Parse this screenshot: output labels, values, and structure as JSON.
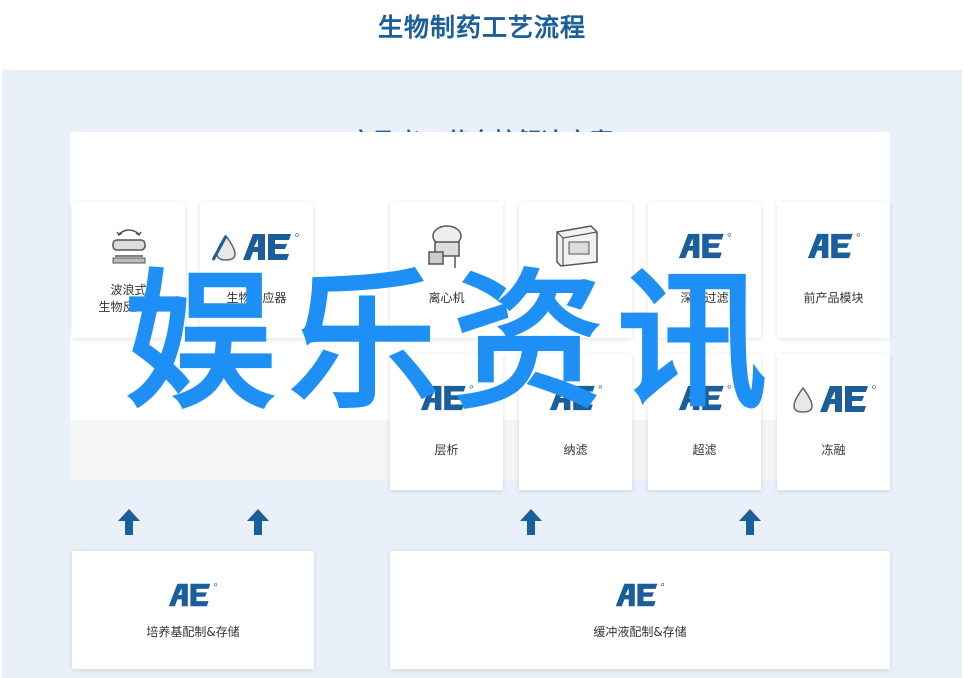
{
  "header": {
    "title": "生物制药工艺流程"
  },
  "panel": {
    "title": "安及义工艺自控解决方案"
  },
  "logo_text": "AE",
  "colors": {
    "brand": "#1a5e9c",
    "panel_bg": "#eaf0fa",
    "watermark": "#1e90f5"
  },
  "top_row": [
    {
      "label": "波浪式\n生物反应器",
      "icon": "wave-bioreactor-icon"
    },
    {
      "label": "生物反应器",
      "icon": "ae-logo-droplet-icon"
    },
    {
      "label": "离心机",
      "icon": "centrifuge-icon"
    },
    {
      "label": "",
      "icon": "equipment-icon"
    },
    {
      "label": "深层过滤",
      "icon": "ae-logo-icon"
    },
    {
      "label": "前产品模块",
      "icon": "ae-logo-icon"
    }
  ],
  "mid_row": [
    {
      "label": "层析",
      "icon": "ae-logo-icon"
    },
    {
      "label": "纳滤",
      "icon": "ae-logo-icon"
    },
    {
      "label": "超滤",
      "icon": "ae-logo-icon"
    },
    {
      "label": "冻融",
      "icon": "ae-logo-droplet-icon"
    }
  ],
  "bottom_row": [
    {
      "label": "培养基配制&存储",
      "icon": "ae-logo-icon"
    },
    {
      "label": "缓冲液配制&存储",
      "icon": "ae-logo-icon"
    }
  ],
  "arrows": [
    "up-arrow-icon",
    "up-arrow-icon",
    "up-arrow-icon",
    "up-arrow-icon"
  ],
  "watermark": "娱乐资讯"
}
